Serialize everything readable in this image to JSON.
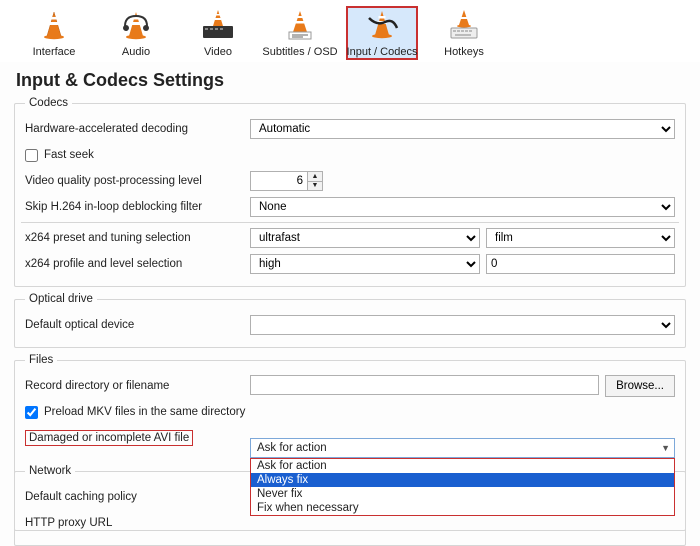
{
  "toolbar": {
    "items": [
      "Interface",
      "Audio",
      "Video",
      "Subtitles / OSD",
      "Input / Codecs",
      "Hotkeys"
    ],
    "active_index": 4
  },
  "page_title": "Input & Codecs Settings",
  "codecs": {
    "legend": "Codecs",
    "hw_decoding_label": "Hardware-accelerated decoding",
    "hw_decoding_value": "Automatic",
    "fast_seek_label": "Fast seek",
    "fast_seek_checked": false,
    "video_quality_label": "Video quality post-processing level",
    "video_quality_value": "6",
    "skip_filter_label": "Skip H.264 in-loop deblocking filter",
    "skip_filter_value": "None",
    "x264_preset_label": "x264 preset and tuning selection",
    "x264_preset_value": "ultrafast",
    "x264_tuning_value": "film",
    "x264_profile_label": "x264 profile and level selection",
    "x264_profile_value": "high",
    "x264_level_value": "0"
  },
  "optical": {
    "legend": "Optical drive",
    "default_device_label": "Default optical device",
    "default_device_value": ""
  },
  "files": {
    "legend": "Files",
    "record_dir_label": "Record directory or filename",
    "record_dir_value": "",
    "browse_label": "Browse...",
    "preload_mkv_label": "Preload MKV files in the same directory",
    "preload_mkv_checked": true,
    "damaged_avi_label": "Damaged or incomplete AVI file",
    "damaged_avi_selected": "Ask for action",
    "damaged_avi_options": [
      "Ask for action",
      "Always fix",
      "Never fix",
      "Fix when necessary"
    ],
    "damaged_avi_highlight_index": 1
  },
  "network": {
    "legend": "Network",
    "caching_label": "Default caching policy",
    "http_proxy_label": "HTTP proxy URL"
  }
}
